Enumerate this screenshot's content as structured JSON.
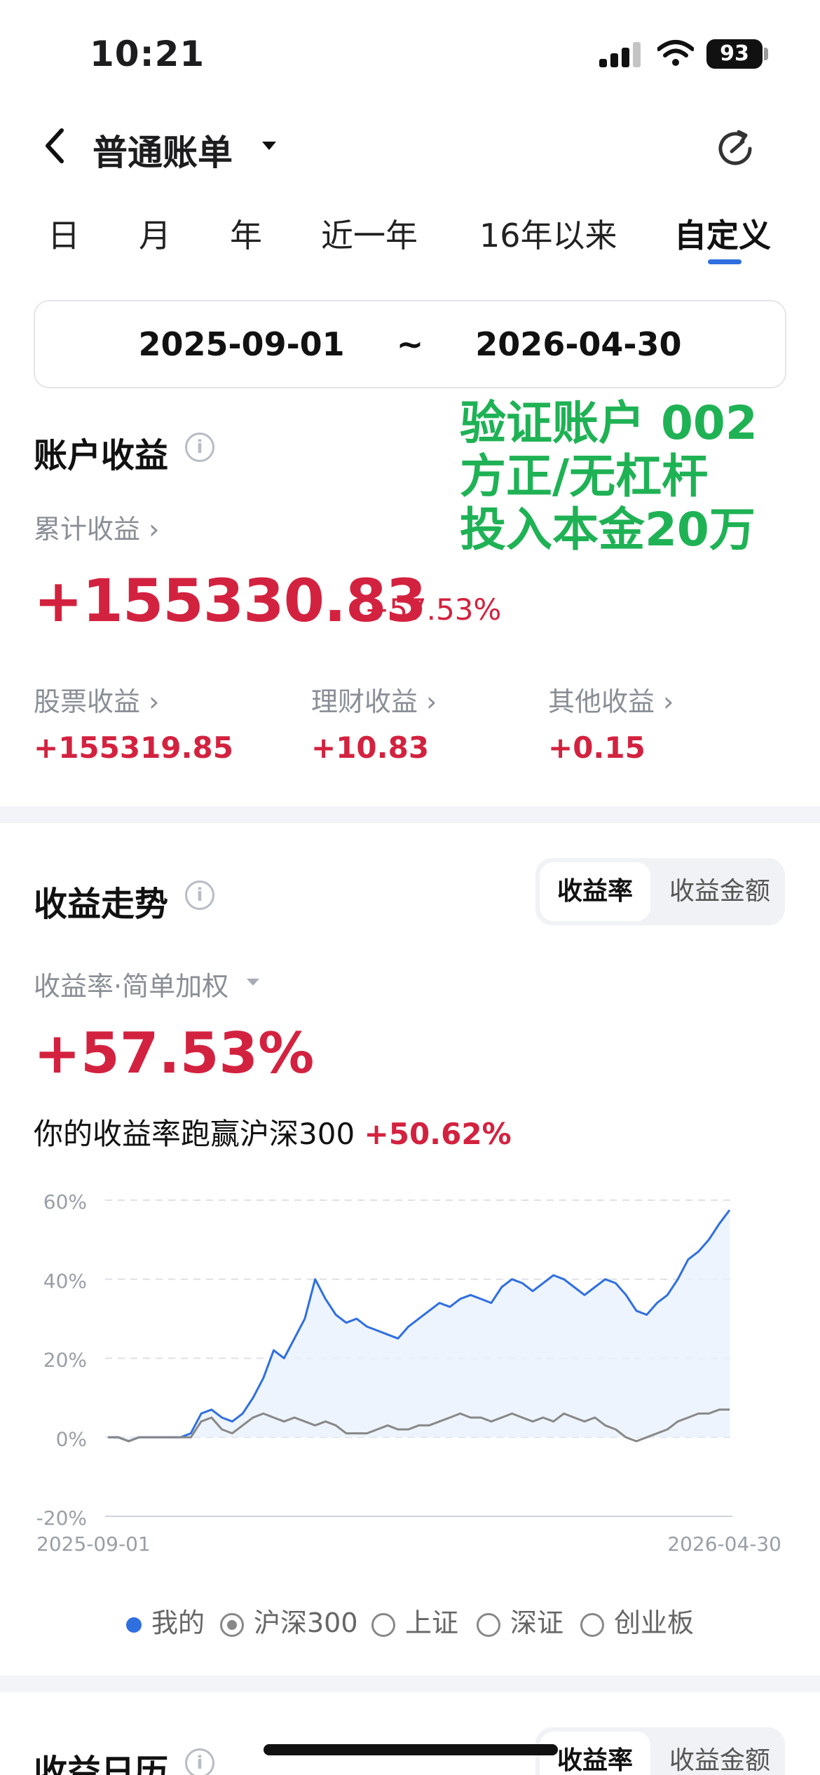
{
  "status_bar": {
    "time": "10:21",
    "battery": "93"
  },
  "header": {
    "title": "普通账单"
  },
  "tabs": [
    {
      "label": "日"
    },
    {
      "label": "月"
    },
    {
      "label": "年"
    },
    {
      "label": "近一年"
    },
    {
      "label": "16年以来"
    },
    {
      "label": "自定义"
    }
  ],
  "date_range": {
    "start": "2025-09-01",
    "separator": "~",
    "end": "2026-04-30"
  },
  "account": {
    "title": "账户收益",
    "cumulative_label": "累计收益",
    "cumulative_value": "+155330.83",
    "cumulative_pct": "+57.53%",
    "breakdown": [
      {
        "label": "股票收益",
        "value": "+155319.85"
      },
      {
        "label": "理财收益",
        "value": "+10.83"
      },
      {
        "label": "其他收益",
        "value": "+0.15"
      }
    ]
  },
  "overlay_note": [
    "验证账户 002",
    "方正/无杠杆",
    "投入本金20万"
  ],
  "trend": {
    "title": "收益走势",
    "toggle": {
      "active": "收益率",
      "inactive": "收益金额"
    },
    "method": "收益率·简单加权",
    "value": "+57.53%",
    "beat_text": "你的收益率跑赢沪深300",
    "beat_pct": "+50.62%"
  },
  "chart_data": {
    "type": "line",
    "x_start_label": "2025-09-01",
    "x_end_label": "2026-04-30",
    "y_ticks": [
      "60%",
      "40%",
      "20%",
      "0%",
      "-20%"
    ],
    "ylim": [
      -20,
      60
    ],
    "grid": true,
    "series": [
      {
        "name": "我的",
        "color": "#2f6fe0",
        "values": [
          0,
          0,
          -1,
          0,
          0,
          0,
          0,
          0,
          1,
          6,
          7,
          5,
          4,
          6,
          10,
          15,
          22,
          20,
          25,
          30,
          40,
          35,
          31,
          29,
          30,
          28,
          27,
          26,
          25,
          28,
          30,
          32,
          34,
          33,
          35,
          36,
          35,
          34,
          38,
          40,
          39,
          37,
          39,
          41,
          40,
          38,
          36,
          38,
          40,
          39,
          36,
          32,
          31,
          34,
          36,
          40,
          45,
          47,
          50,
          54,
          57.5
        ]
      },
      {
        "name": "沪深300",
        "color": "#888888",
        "values": [
          0,
          0,
          -1,
          0,
          0,
          0,
          0,
          0,
          0,
          4,
          5,
          2,
          1,
          3,
          5,
          6,
          5,
          4,
          5,
          4,
          3,
          4,
          3,
          1,
          1,
          1,
          2,
          3,
          2,
          2,
          3,
          3,
          4,
          5,
          6,
          5,
          5,
          4,
          5,
          6,
          5,
          4,
          5,
          4,
          6,
          5,
          4,
          5,
          3,
          2,
          0,
          -1,
          0,
          1,
          2,
          4,
          5,
          6,
          6,
          7,
          7
        ]
      }
    ]
  },
  "legend": [
    {
      "label": "我的",
      "kind": "dot"
    },
    {
      "label": "沪深300",
      "kind": "radio-checked"
    },
    {
      "label": "上证",
      "kind": "radio"
    },
    {
      "label": "深证",
      "kind": "radio"
    },
    {
      "label": "创业板",
      "kind": "radio"
    }
  ],
  "calendar": {
    "title": "收益日历",
    "toggle": {
      "active": "收益率",
      "inactive": "收益金额"
    }
  },
  "colors": {
    "red": "#d3223f",
    "accent": "#2f6fe0",
    "note_green": "#1fb255"
  }
}
